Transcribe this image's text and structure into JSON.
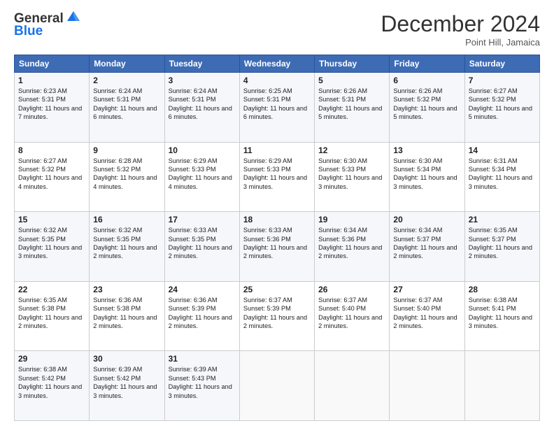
{
  "header": {
    "logo_line1": "General",
    "logo_line2": "Blue",
    "month": "December 2024",
    "location": "Point Hill, Jamaica"
  },
  "weekdays": [
    "Sunday",
    "Monday",
    "Tuesday",
    "Wednesday",
    "Thursday",
    "Friday",
    "Saturday"
  ],
  "weeks": [
    [
      {
        "day": "1",
        "sunrise": "6:23 AM",
        "sunset": "5:31 PM",
        "daylight": "11 hours and 7 minutes."
      },
      {
        "day": "2",
        "sunrise": "6:24 AM",
        "sunset": "5:31 PM",
        "daylight": "11 hours and 6 minutes."
      },
      {
        "day": "3",
        "sunrise": "6:24 AM",
        "sunset": "5:31 PM",
        "daylight": "11 hours and 6 minutes."
      },
      {
        "day": "4",
        "sunrise": "6:25 AM",
        "sunset": "5:31 PM",
        "daylight": "11 hours and 6 minutes."
      },
      {
        "day": "5",
        "sunrise": "6:26 AM",
        "sunset": "5:31 PM",
        "daylight": "11 hours and 5 minutes."
      },
      {
        "day": "6",
        "sunrise": "6:26 AM",
        "sunset": "5:32 PM",
        "daylight": "11 hours and 5 minutes."
      },
      {
        "day": "7",
        "sunrise": "6:27 AM",
        "sunset": "5:32 PM",
        "daylight": "11 hours and 5 minutes."
      }
    ],
    [
      {
        "day": "8",
        "sunrise": "6:27 AM",
        "sunset": "5:32 PM",
        "daylight": "11 hours and 4 minutes."
      },
      {
        "day": "9",
        "sunrise": "6:28 AM",
        "sunset": "5:32 PM",
        "daylight": "11 hours and 4 minutes."
      },
      {
        "day": "10",
        "sunrise": "6:29 AM",
        "sunset": "5:33 PM",
        "daylight": "11 hours and 4 minutes."
      },
      {
        "day": "11",
        "sunrise": "6:29 AM",
        "sunset": "5:33 PM",
        "daylight": "11 hours and 3 minutes."
      },
      {
        "day": "12",
        "sunrise": "6:30 AM",
        "sunset": "5:33 PM",
        "daylight": "11 hours and 3 minutes."
      },
      {
        "day": "13",
        "sunrise": "6:30 AM",
        "sunset": "5:34 PM",
        "daylight": "11 hours and 3 minutes."
      },
      {
        "day": "14",
        "sunrise": "6:31 AM",
        "sunset": "5:34 PM",
        "daylight": "11 hours and 3 minutes."
      }
    ],
    [
      {
        "day": "15",
        "sunrise": "6:32 AM",
        "sunset": "5:35 PM",
        "daylight": "11 hours and 3 minutes."
      },
      {
        "day": "16",
        "sunrise": "6:32 AM",
        "sunset": "5:35 PM",
        "daylight": "11 hours and 2 minutes."
      },
      {
        "day": "17",
        "sunrise": "6:33 AM",
        "sunset": "5:35 PM",
        "daylight": "11 hours and 2 minutes."
      },
      {
        "day": "18",
        "sunrise": "6:33 AM",
        "sunset": "5:36 PM",
        "daylight": "11 hours and 2 minutes."
      },
      {
        "day": "19",
        "sunrise": "6:34 AM",
        "sunset": "5:36 PM",
        "daylight": "11 hours and 2 minutes."
      },
      {
        "day": "20",
        "sunrise": "6:34 AM",
        "sunset": "5:37 PM",
        "daylight": "11 hours and 2 minutes."
      },
      {
        "day": "21",
        "sunrise": "6:35 AM",
        "sunset": "5:37 PM",
        "daylight": "11 hours and 2 minutes."
      }
    ],
    [
      {
        "day": "22",
        "sunrise": "6:35 AM",
        "sunset": "5:38 PM",
        "daylight": "11 hours and 2 minutes."
      },
      {
        "day": "23",
        "sunrise": "6:36 AM",
        "sunset": "5:38 PM",
        "daylight": "11 hours and 2 minutes."
      },
      {
        "day": "24",
        "sunrise": "6:36 AM",
        "sunset": "5:39 PM",
        "daylight": "11 hours and 2 minutes."
      },
      {
        "day": "25",
        "sunrise": "6:37 AM",
        "sunset": "5:39 PM",
        "daylight": "11 hours and 2 minutes."
      },
      {
        "day": "26",
        "sunrise": "6:37 AM",
        "sunset": "5:40 PM",
        "daylight": "11 hours and 2 minutes."
      },
      {
        "day": "27",
        "sunrise": "6:37 AM",
        "sunset": "5:40 PM",
        "daylight": "11 hours and 2 minutes."
      },
      {
        "day": "28",
        "sunrise": "6:38 AM",
        "sunset": "5:41 PM",
        "daylight": "11 hours and 3 minutes."
      }
    ],
    [
      {
        "day": "29",
        "sunrise": "6:38 AM",
        "sunset": "5:42 PM",
        "daylight": "11 hours and 3 minutes."
      },
      {
        "day": "30",
        "sunrise": "6:39 AM",
        "sunset": "5:42 PM",
        "daylight": "11 hours and 3 minutes."
      },
      {
        "day": "31",
        "sunrise": "6:39 AM",
        "sunset": "5:43 PM",
        "daylight": "11 hours and 3 minutes."
      },
      null,
      null,
      null,
      null
    ]
  ]
}
